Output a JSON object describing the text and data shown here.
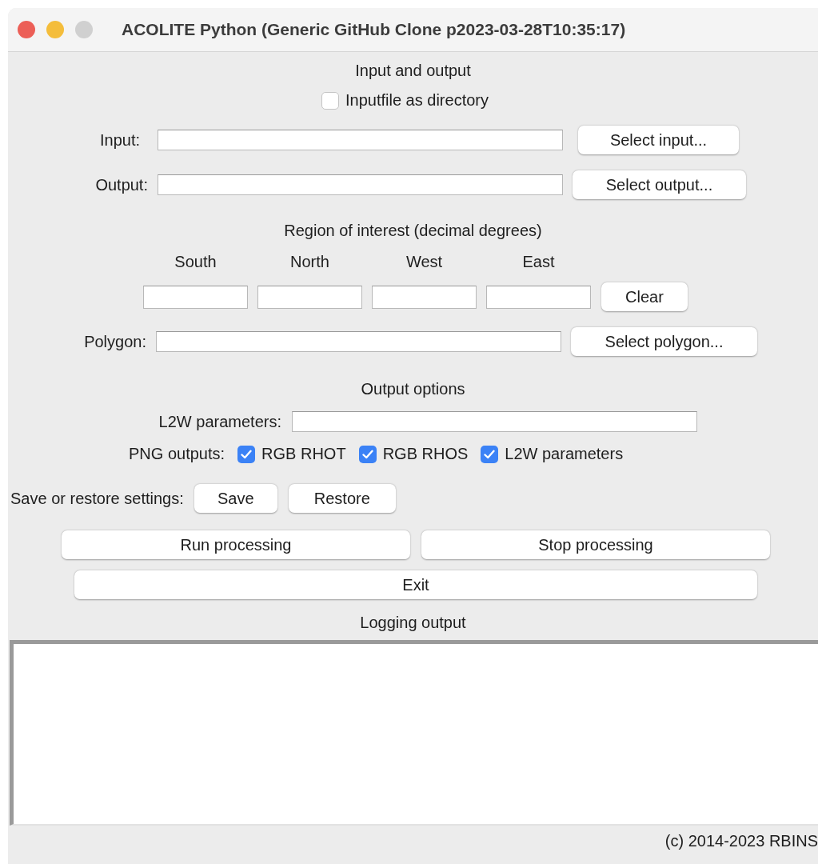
{
  "window": {
    "title": "ACOLITE Python (Generic GitHub Clone p2023-03-28T10:35:17)"
  },
  "io": {
    "heading": "Input and output",
    "directory_checkbox": {
      "label": "Inputfile as directory",
      "checked": false
    },
    "rows": [
      {
        "label": "Input:",
        "button": "Select input..."
      },
      {
        "label": "Output:",
        "button": "Select output..."
      }
    ]
  },
  "roi": {
    "heading": "Region of interest (decimal degrees)",
    "columns": [
      "South",
      "North",
      "West",
      "East"
    ],
    "clear_button": "Clear",
    "polygon": {
      "label": "Polygon:",
      "button": "Select polygon..."
    }
  },
  "output_options": {
    "heading": "Output options",
    "l2w_label": "L2W parameters:",
    "png_label": "PNG outputs:",
    "png_checkboxes": [
      {
        "label": "RGB RHOT",
        "checked": true
      },
      {
        "label": "RGB RHOS",
        "checked": true
      },
      {
        "label": "L2W parameters",
        "checked": true
      }
    ]
  },
  "settings": {
    "label": "Save or restore settings:",
    "buttons": [
      "Save",
      "Restore"
    ]
  },
  "processing_buttons": [
    "Run processing",
    "Stop processing"
  ],
  "exit_button": "Exit",
  "logging": {
    "heading": "Logging output"
  },
  "footer": "(c) 2014-2023 RBINS"
}
